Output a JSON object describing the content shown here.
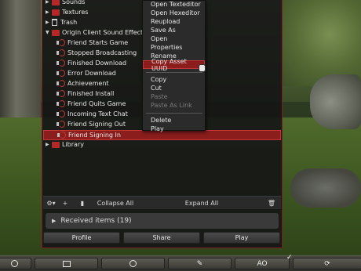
{
  "tree": {
    "items": [
      {
        "label": "Sounds",
        "kind": "folder",
        "indent": 0,
        "expanded": false
      },
      {
        "label": "Textures",
        "kind": "folder",
        "indent": 0,
        "expanded": false
      },
      {
        "label": "Trash",
        "kind": "trash",
        "indent": 0,
        "expanded": false
      },
      {
        "label": "Origin Client Sound Effects",
        "kind": "folder",
        "indent": 0,
        "expanded": true
      },
      {
        "label": "Friend Starts Game",
        "kind": "sound",
        "indent": 1
      },
      {
        "label": "Stopped Broadcasting",
        "kind": "sound",
        "indent": 1
      },
      {
        "label": "Finished Download",
        "kind": "sound",
        "indent": 1
      },
      {
        "label": "Error Download",
        "kind": "sound",
        "indent": 1
      },
      {
        "label": "Achievement",
        "kind": "sound",
        "indent": 1
      },
      {
        "label": "Finished Install",
        "kind": "sound",
        "indent": 1
      },
      {
        "label": "Friend Quits Game",
        "kind": "sound",
        "indent": 1
      },
      {
        "label": "Incoming Text Chat",
        "kind": "sound",
        "indent": 1
      },
      {
        "label": "Friend Signing Out",
        "kind": "sound",
        "indent": 1
      },
      {
        "label": "Friend Signing In",
        "kind": "sound",
        "indent": 1,
        "selected": true
      },
      {
        "label": "Library",
        "kind": "folder",
        "indent": 0,
        "expanded": false
      }
    ]
  },
  "toolbar": {
    "gear_icon": "gear-icon",
    "add_label": "+",
    "collapse_all": "Collapse All",
    "expand_all": "Expand All",
    "trash_icon": "trash-icon"
  },
  "received": {
    "label": "Received items (19)"
  },
  "buttons": {
    "profile": "Profile",
    "share": "Share",
    "play": "Play"
  },
  "context_menu": {
    "items": [
      {
        "label": "Open Texteditor",
        "disabled": false
      },
      {
        "label": "Open Hexeditor",
        "disabled": false
      },
      {
        "label": "Reupload",
        "disabled": false
      },
      {
        "label": "Save As",
        "disabled": false
      },
      {
        "label": "Open",
        "disabled": false
      },
      {
        "label": "Properties",
        "disabled": false
      },
      {
        "label": "Rename",
        "disabled": false
      },
      {
        "label": "Copy Asset UUID",
        "disabled": false,
        "hover": true
      },
      {
        "separator": true
      },
      {
        "label": "Copy",
        "disabled": false
      },
      {
        "label": "Cut",
        "disabled": false
      },
      {
        "label": "Paste",
        "disabled": true
      },
      {
        "label": "Paste As Link",
        "disabled": true
      },
      {
        "separator": true
      },
      {
        "label": "Delete",
        "disabled": false
      },
      {
        "label": "Play",
        "disabled": false
      }
    ]
  },
  "bottombar": {
    "ao_label": "AO",
    "check_glyph": "✓",
    "icons": [
      "search-icon",
      "map-icon",
      "location-icon",
      "tools-icon",
      "refresh-icon"
    ]
  },
  "colors": {
    "selection": "#8b1d1d",
    "folder": "#b42828",
    "panel_border": "#7a1f1f"
  }
}
